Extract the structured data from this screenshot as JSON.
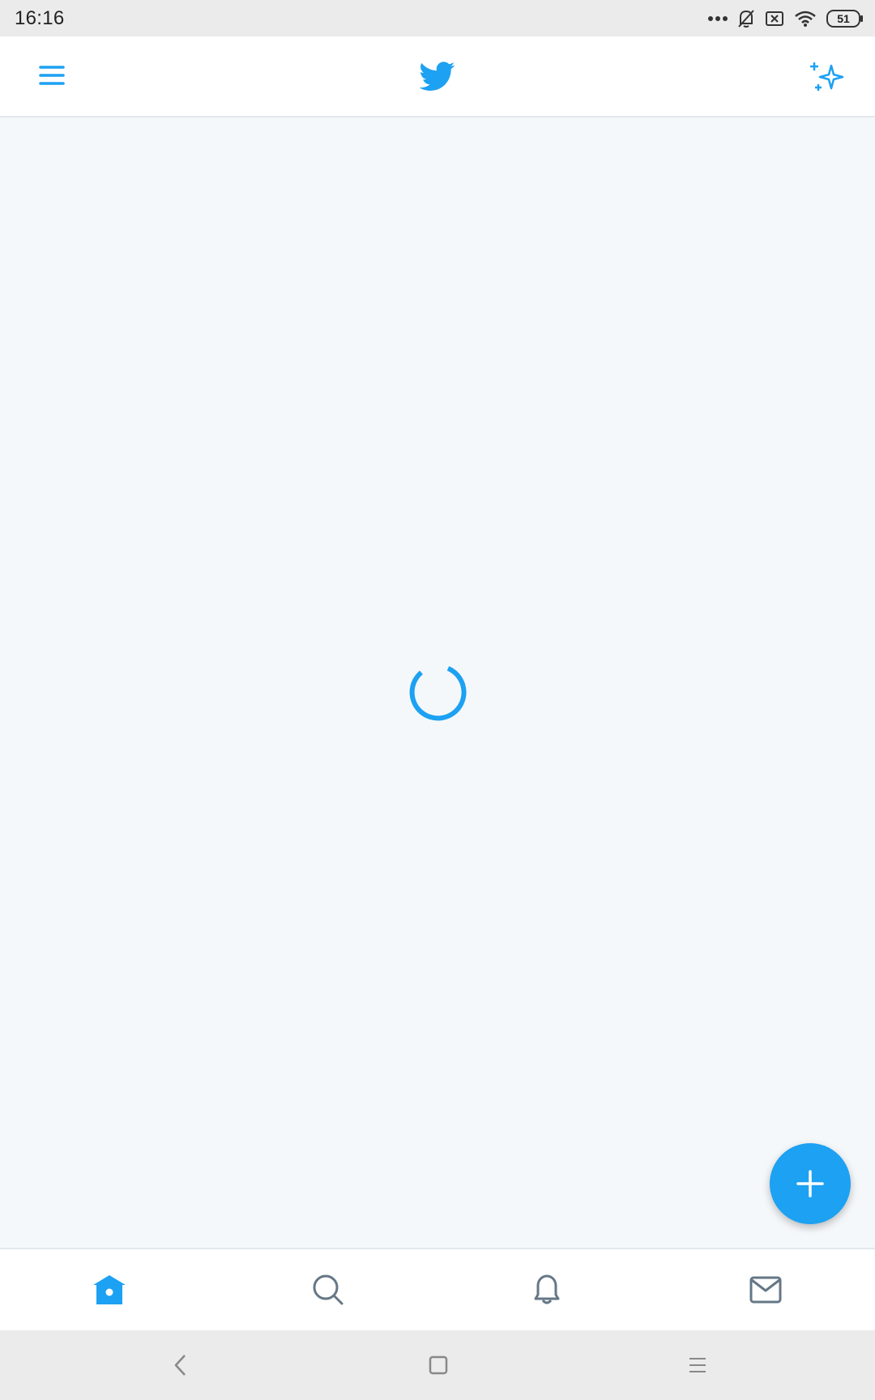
{
  "status_bar": {
    "time": "16:16",
    "battery_level": "51",
    "icons": [
      "more-dots-icon",
      "bell-muted-icon",
      "sim-off-icon",
      "wifi-icon",
      "battery-icon"
    ]
  },
  "header": {
    "menu_icon": "hamburger-menu-icon",
    "logo_icon": "twitter-bird-icon",
    "sparkle_icon": "sparkle-icon"
  },
  "feed": {
    "loading": true,
    "spinner_icon": "loading-spinner-icon"
  },
  "compose_button": {
    "icon": "plus-icon"
  },
  "bottom_nav": {
    "items": [
      {
        "name": "home",
        "icon": "home-icon",
        "active": true
      },
      {
        "name": "search",
        "icon": "search-icon",
        "active": false
      },
      {
        "name": "notifications",
        "icon": "bell-icon",
        "active": false
      },
      {
        "name": "messages",
        "icon": "mail-icon",
        "active": false
      }
    ]
  },
  "system_nav": {
    "buttons": [
      "back-icon",
      "home-square-icon",
      "recent-apps-icon"
    ]
  },
  "colors": {
    "brand": "#1da1f2",
    "background": "#f5f8fa",
    "inactive_icon": "#657786",
    "border": "#e1e8ed"
  }
}
